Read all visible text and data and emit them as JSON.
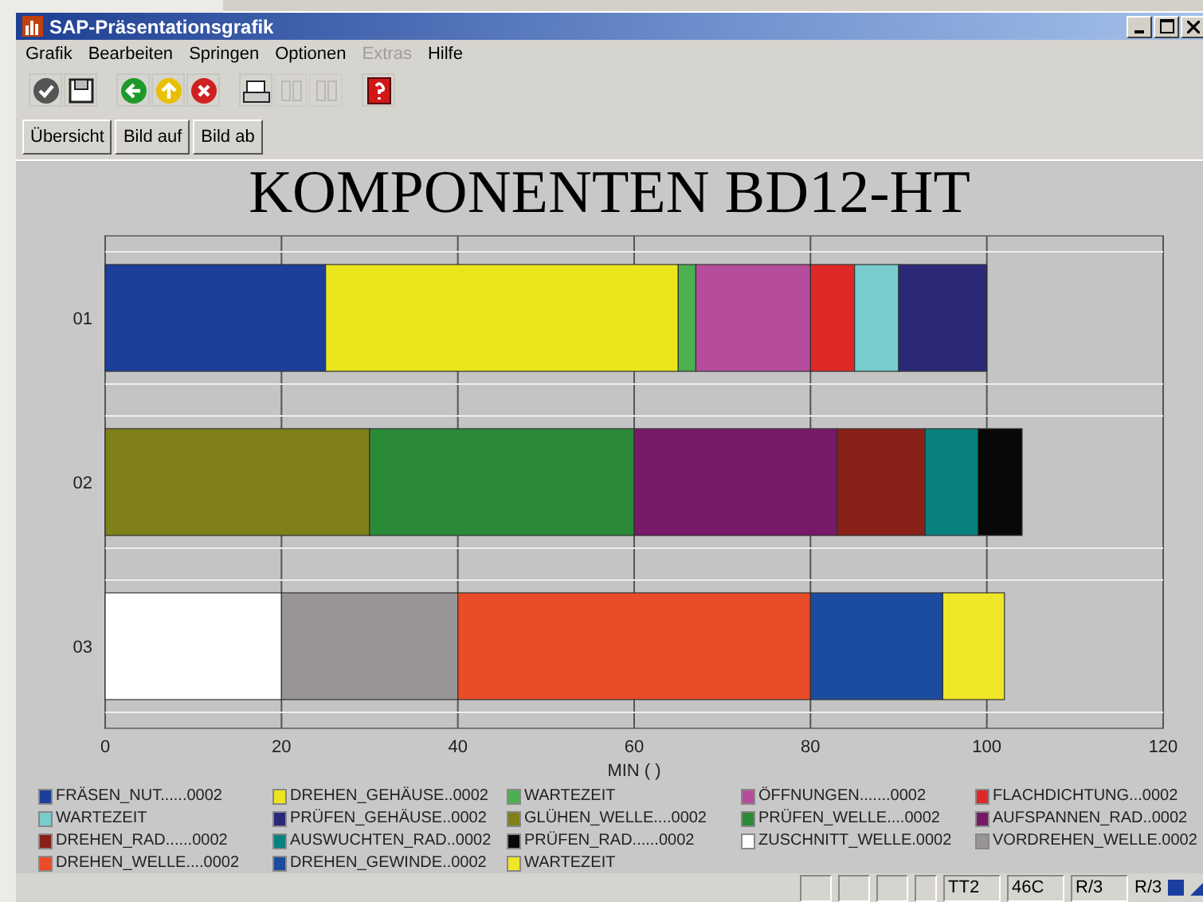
{
  "window": {
    "title": "SAP-Präsentationsgrafik"
  },
  "menu": [
    {
      "label": "Grafik",
      "disabled": false
    },
    {
      "label": "Bearbeiten",
      "disabled": false
    },
    {
      "label": "Springen",
      "disabled": false
    },
    {
      "label": "Optionen",
      "disabled": false
    },
    {
      "label": "Extras",
      "disabled": true
    },
    {
      "label": "Hilfe",
      "disabled": false
    }
  ],
  "toolbar": [
    {
      "kind": "check",
      "disabled": false
    },
    {
      "kind": "save",
      "disabled": false
    },
    {
      "kind": "sep"
    },
    {
      "kind": "back",
      "disabled": false
    },
    {
      "kind": "up",
      "disabled": false
    },
    {
      "kind": "cancel",
      "disabled": false
    },
    {
      "kind": "sep"
    },
    {
      "kind": "print",
      "disabled": false
    },
    {
      "kind": "find",
      "disabled": true
    },
    {
      "kind": "findnext",
      "disabled": true
    },
    {
      "kind": "sep"
    },
    {
      "kind": "help",
      "disabled": false
    }
  ],
  "buttons": [
    "Übersicht",
    "Bild auf",
    "Bild ab"
  ],
  "chart": {
    "chart_data": {
      "type": "bar",
      "orientation": "horizontal",
      "stacked": true,
      "grid": true,
      "title": "KOMPONENTEN BD12-HT",
      "xlabel": "MIN ( )",
      "categories": [
        "01",
        "02",
        "03"
      ],
      "xlim": [
        0,
        120
      ],
      "xticks": [
        0,
        20,
        40,
        60,
        80,
        100,
        120
      ],
      "series": [
        {
          "name": "FRÄSEN_NUT......0002",
          "color": "#1c3f9c",
          "values": [
            25,
            null,
            null
          ]
        },
        {
          "name": "DREHEN_GEHÄUSE..0002",
          "color": "#ebe51e",
          "values": [
            40,
            null,
            null
          ]
        },
        {
          "name": "WARTEZEIT",
          "color": "#4caf50",
          "values": [
            2,
            null,
            null
          ]
        },
        {
          "name": "ÖFFNUNGEN.......0002",
          "color": "#b84c9c",
          "values": [
            13,
            null,
            null
          ]
        },
        {
          "name": "FLACHDICHTUNG...0002",
          "color": "#e02828",
          "values": [
            5,
            null,
            null
          ]
        },
        {
          "name": "WARTEZEIT",
          "color": "#78cccc",
          "values": [
            5,
            null,
            null
          ]
        },
        {
          "name": "PRÜFEN_GEHÄUSE..0002",
          "color": "#2c2878",
          "values": [
            10,
            null,
            null
          ]
        },
        {
          "name": "GLÜHEN_WELLE....0002",
          "color": "#808018",
          "values": [
            null,
            30,
            null
          ]
        },
        {
          "name": "PRÜFEN_WELLE....0002",
          "color": "#2a8a38",
          "values": [
            null,
            30,
            null
          ]
        },
        {
          "name": "AUFSPANNEN_RAD..0002",
          "color": "#781868",
          "values": [
            null,
            23,
            null
          ]
        },
        {
          "name": "DREHEN_RAD......0002",
          "color": "#882018",
          "values": [
            null,
            10,
            null
          ]
        },
        {
          "name": "AUSWUCHTEN_RAD..0002",
          "color": "#08807e",
          "values": [
            null,
            6,
            null
          ]
        },
        {
          "name": "PRÜFEN_RAD......0002",
          "color": "#080808",
          "values": [
            null,
            5,
            null
          ]
        },
        {
          "name": "ZUSCHNITT_WELLE.0002",
          "color": "#ffffff",
          "values": [
            null,
            null,
            20
          ]
        },
        {
          "name": "VORDREHEN_WELLE.0002",
          "color": "#989498",
          "values": [
            null,
            null,
            20
          ]
        },
        {
          "name": "DREHEN_WELLE....0002",
          "color": "#e84c28",
          "values": [
            null,
            null,
            40
          ]
        },
        {
          "name": "DREHEN_GEWINDE..0002",
          "color": "#1c4ca0",
          "values": [
            null,
            null,
            15
          ]
        },
        {
          "name": "WARTEZEIT",
          "color": "#f0e628",
          "values": [
            null,
            null,
            7
          ]
        }
      ]
    }
  },
  "status_bar": [
    "TT2",
    "46C",
    "R/3",
    "R/3"
  ]
}
